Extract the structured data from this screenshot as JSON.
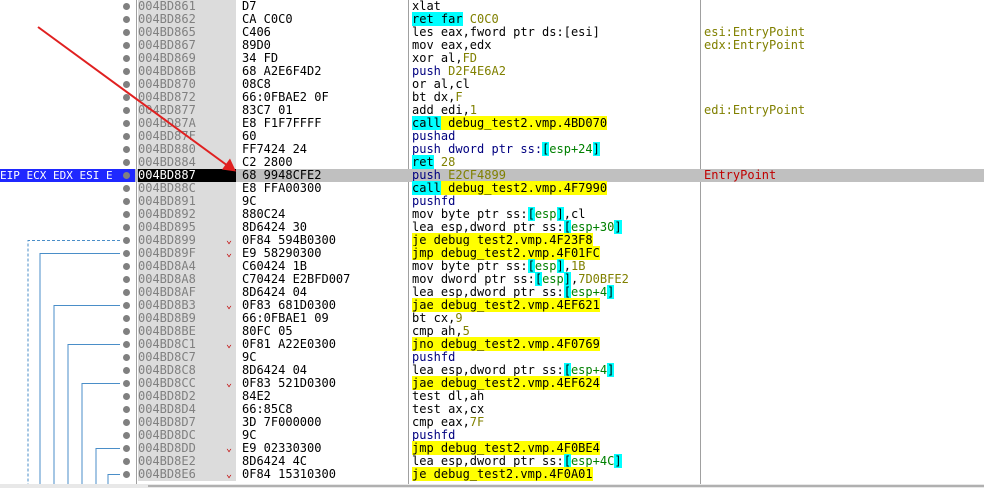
{
  "eip_row": {
    "registers": "EIP ECX EDX ESI E"
  },
  "rows": [
    {
      "addr": "004BD861",
      "bytes": "D7",
      "jmark": "",
      "instr": [
        {
          "t": "xlat",
          "c": "m"
        }
      ],
      "comment": ""
    },
    {
      "addr": "004BD862",
      "bytes": "CA C0C0",
      "jmark": "",
      "instr": [
        {
          "t": "ret far",
          "c": "m",
          "hl": "cyan"
        },
        {
          "t": " C0C0",
          "c": "s"
        }
      ],
      "comment": ""
    },
    {
      "addr": "004BD865",
      "bytes": "C406",
      "jmark": "",
      "instr": [
        {
          "t": "les eax,fword ptr ds:[esi]",
          "c": "m"
        }
      ],
      "comment": "esi:EntryPoint"
    },
    {
      "addr": "004BD867",
      "bytes": "89D0",
      "jmark": "",
      "instr": [
        {
          "t": "mov eax,edx",
          "c": "m"
        }
      ],
      "comment": "edx:EntryPoint"
    },
    {
      "addr": "004BD869",
      "bytes": "34 FD",
      "jmark": "",
      "instr": [
        {
          "t": "xor al,",
          "c": "m"
        },
        {
          "t": "FD",
          "c": "s"
        }
      ],
      "comment": ""
    },
    {
      "addr": "004BD86B",
      "bytes": "68 A2E6F4D2",
      "jmark": "",
      "instr": [
        {
          "t": "push ",
          "c": "b"
        },
        {
          "t": "D2F4E6A2",
          "c": "s"
        }
      ],
      "comment": ""
    },
    {
      "addr": "004BD870",
      "bytes": "08C8",
      "jmark": "",
      "instr": [
        {
          "t": "or al,cl",
          "c": "m"
        }
      ],
      "comment": ""
    },
    {
      "addr": "004BD872",
      "bytes": "66:0FBAE2 0F",
      "jmark": "",
      "instr": [
        {
          "t": "bt dx,",
          "c": "m"
        },
        {
          "t": "F",
          "c": "s"
        }
      ],
      "comment": ""
    },
    {
      "addr": "004BD877",
      "bytes": "83C7 01",
      "jmark": "",
      "instr": [
        {
          "t": "add edi,",
          "c": "m"
        },
        {
          "t": "1",
          "c": "s"
        }
      ],
      "comment": "edi:EntryPoint"
    },
    {
      "addr": "004BD87A",
      "bytes": "E8 F1F7FFFF",
      "jmark": "",
      "instr": [
        {
          "t": "call",
          "c": "m",
          "hl": "cyan"
        },
        {
          "t": " debug_test2.vmp.4BD070",
          "c": "m",
          "hl": "yel"
        }
      ],
      "comment": ""
    },
    {
      "addr": "004BD87F",
      "bytes": "60",
      "jmark": "",
      "instr": [
        {
          "t": "pushad",
          "c": "b"
        }
      ],
      "comment": ""
    },
    {
      "addr": "004BD880",
      "bytes": "FF7424 24",
      "jmark": "",
      "instr": [
        {
          "t": "push dword ptr ss:",
          "c": "b"
        },
        {
          "t": "[",
          "c": "m",
          "hl": "cyan"
        },
        {
          "t": "esp+24",
          "c": "o"
        },
        {
          "t": "]",
          "c": "m",
          "hl": "cyan"
        }
      ],
      "comment": ""
    },
    {
      "addr": "004BD884",
      "bytes": "C2 2800",
      "jmark": "",
      "instr": [
        {
          "t": "ret",
          "c": "m",
          "hl": "cyan"
        },
        {
          "t": " 28",
          "c": "s"
        }
      ],
      "comment": ""
    },
    {
      "addr": "004BD887",
      "bytes": "68 9948CFE2",
      "jmark": "",
      "instr": [
        {
          "t": "push ",
          "c": "b"
        },
        {
          "t": "E2CF4899",
          "c": "s"
        }
      ],
      "comment": "EntryPoint",
      "sel": true
    },
    {
      "addr": "004BD88C",
      "bytes": "E8 FFA00300",
      "jmark": "",
      "instr": [
        {
          "t": "call",
          "c": "m",
          "hl": "cyan"
        },
        {
          "t": " debug_test2.vmp.4F7990",
          "c": "m",
          "hl": "yel"
        }
      ],
      "comment": ""
    },
    {
      "addr": "004BD891",
      "bytes": "9C",
      "jmark": "",
      "instr": [
        {
          "t": "pushfd",
          "c": "b"
        }
      ],
      "comment": ""
    },
    {
      "addr": "004BD892",
      "bytes": "880C24",
      "jmark": "",
      "instr": [
        {
          "t": "mov byte ptr ss:",
          "c": "m"
        },
        {
          "t": "[",
          "c": "m",
          "hl": "cyan"
        },
        {
          "t": "esp",
          "c": "o"
        },
        {
          "t": "]",
          "c": "m",
          "hl": "cyan"
        },
        {
          "t": ",cl",
          "c": "m"
        }
      ],
      "comment": ""
    },
    {
      "addr": "004BD895",
      "bytes": "8D6424 30",
      "jmark": "",
      "instr": [
        {
          "t": "lea esp,dword ptr ss:",
          "c": "m"
        },
        {
          "t": "[",
          "c": "m",
          "hl": "cyan"
        },
        {
          "t": "esp+30",
          "c": "o"
        },
        {
          "t": "]",
          "c": "m",
          "hl": "cyan"
        }
      ],
      "comment": ""
    },
    {
      "addr": "004BD899",
      "bytes": "0F84 594B0300",
      "jmark": "⌄",
      "instr": [
        {
          "t": "je",
          "c": "m",
          "hl": "yel"
        },
        {
          "t": " debug_test2.vmp.4F23F8",
          "c": "m",
          "hl": "yel"
        }
      ],
      "comment": ""
    },
    {
      "addr": "004BD89F",
      "bytes": "E9 58290300",
      "jmark": "⌄",
      "instr": [
        {
          "t": "jmp",
          "c": "m",
          "hl": "yel"
        },
        {
          "t": " debug_test2.vmp.4F01FC",
          "c": "m",
          "hl": "yel"
        }
      ],
      "comment": ""
    },
    {
      "addr": "004BD8A4",
      "bytes": "C60424 1B",
      "jmark": "",
      "instr": [
        {
          "t": "mov byte ptr ss:",
          "c": "m"
        },
        {
          "t": "[",
          "c": "m",
          "hl": "cyan"
        },
        {
          "t": "esp",
          "c": "o"
        },
        {
          "t": "]",
          "c": "m",
          "hl": "cyan"
        },
        {
          "t": ",",
          "c": "m"
        },
        {
          "t": "1B",
          "c": "s"
        }
      ],
      "comment": ""
    },
    {
      "addr": "004BD8A8",
      "bytes": "C70424 E2BFD007",
      "jmark": "",
      "instr": [
        {
          "t": "mov dword ptr ss:",
          "c": "m"
        },
        {
          "t": "[",
          "c": "m",
          "hl": "cyan"
        },
        {
          "t": "esp",
          "c": "o"
        },
        {
          "t": "]",
          "c": "m",
          "hl": "cyan"
        },
        {
          "t": ",",
          "c": "m"
        },
        {
          "t": "7D0BFE2",
          "c": "s"
        }
      ],
      "comment": ""
    },
    {
      "addr": "004BD8AF",
      "bytes": "8D6424 04",
      "jmark": "",
      "instr": [
        {
          "t": "lea esp,dword ptr ss:",
          "c": "m"
        },
        {
          "t": "[",
          "c": "m",
          "hl": "cyan"
        },
        {
          "t": "esp+4",
          "c": "o"
        },
        {
          "t": "]",
          "c": "m",
          "hl": "cyan"
        }
      ],
      "comment": ""
    },
    {
      "addr": "004BD8B3",
      "bytes": "0F83 681D0300",
      "jmark": "⌄",
      "instr": [
        {
          "t": "jae",
          "c": "m",
          "hl": "yel"
        },
        {
          "t": " debug_test2.vmp.4EF621",
          "c": "m",
          "hl": "yel"
        }
      ],
      "comment": ""
    },
    {
      "addr": "004BD8B9",
      "bytes": "66:0FBAE1 09",
      "jmark": "",
      "instr": [
        {
          "t": "bt cx,",
          "c": "m"
        },
        {
          "t": "9",
          "c": "s"
        }
      ],
      "comment": ""
    },
    {
      "addr": "004BD8BE",
      "bytes": "80FC 05",
      "jmark": "",
      "instr": [
        {
          "t": "cmp ah,",
          "c": "m"
        },
        {
          "t": "5",
          "c": "s"
        }
      ],
      "comment": ""
    },
    {
      "addr": "004BD8C1",
      "bytes": "0F81 A22E0300",
      "jmark": "⌄",
      "instr": [
        {
          "t": "jno",
          "c": "m",
          "hl": "yel"
        },
        {
          "t": " debug_test2.vmp.4F0769",
          "c": "m",
          "hl": "yel"
        }
      ],
      "comment": ""
    },
    {
      "addr": "004BD8C7",
      "bytes": "9C",
      "jmark": "",
      "instr": [
        {
          "t": "pushfd",
          "c": "b"
        }
      ],
      "comment": ""
    },
    {
      "addr": "004BD8C8",
      "bytes": "8D6424 04",
      "jmark": "",
      "instr": [
        {
          "t": "lea esp,dword ptr ss:",
          "c": "m"
        },
        {
          "t": "[",
          "c": "m",
          "hl": "cyan"
        },
        {
          "t": "esp+4",
          "c": "o"
        },
        {
          "t": "]",
          "c": "m",
          "hl": "cyan"
        }
      ],
      "comment": ""
    },
    {
      "addr": "004BD8CC",
      "bytes": "0F83 521D0300",
      "jmark": "⌄",
      "instr": [
        {
          "t": "jae",
          "c": "m",
          "hl": "yel"
        },
        {
          "t": " debug_test2.vmp.4EF624",
          "c": "m",
          "hl": "yel"
        }
      ],
      "comment": ""
    },
    {
      "addr": "004BD8D2",
      "bytes": "84E2",
      "jmark": "",
      "instr": [
        {
          "t": "test dl,ah",
          "c": "m"
        }
      ],
      "comment": ""
    },
    {
      "addr": "004BD8D4",
      "bytes": "66:85C8",
      "jmark": "",
      "instr": [
        {
          "t": "test ax,cx",
          "c": "m"
        }
      ],
      "comment": ""
    },
    {
      "addr": "004BD8D7",
      "bytes": "3D 7F000000",
      "jmark": "",
      "instr": [
        {
          "t": "cmp eax,",
          "c": "m"
        },
        {
          "t": "7F",
          "c": "s"
        }
      ],
      "comment": ""
    },
    {
      "addr": "004BD8DC",
      "bytes": "9C",
      "jmark": "",
      "instr": [
        {
          "t": "pushfd",
          "c": "b"
        }
      ],
      "comment": ""
    },
    {
      "addr": "004BD8DD",
      "bytes": "E9 02330300",
      "jmark": "⌄",
      "instr": [
        {
          "t": "jmp",
          "c": "m",
          "hl": "yel"
        },
        {
          "t": " debug_test2.vmp.4F0BE4",
          "c": "m",
          "hl": "yel"
        }
      ],
      "comment": ""
    },
    {
      "addr": "004BD8E2",
      "bytes": "8D6424 4C",
      "jmark": "",
      "instr": [
        {
          "t": "lea esp,dword ptr ss:",
          "c": "m"
        },
        {
          "t": "[",
          "c": "m",
          "hl": "cyan"
        },
        {
          "t": "esp+4C",
          "c": "o"
        },
        {
          "t": "]",
          "c": "m",
          "hl": "cyan"
        }
      ],
      "comment": ""
    },
    {
      "addr": "004BD8E6",
      "bytes": "0F84 15310300",
      "jmark": "⌄",
      "instr": [
        {
          "t": "je",
          "c": "m",
          "hl": "yel"
        },
        {
          "t": " debug_test2.vmp.4F0A01",
          "c": "m",
          "hl": "yel"
        }
      ],
      "comment": ""
    }
  ],
  "colors": {
    "selected_row": "#c0c0c0",
    "register_badge": "#1f28ff",
    "call_ret_highlight": "#00ffff",
    "jump_highlight": "#ffff00",
    "comment_text": "#808000",
    "entrypoint_comment": "#c00000",
    "annotation_arrow": "#e02020"
  }
}
